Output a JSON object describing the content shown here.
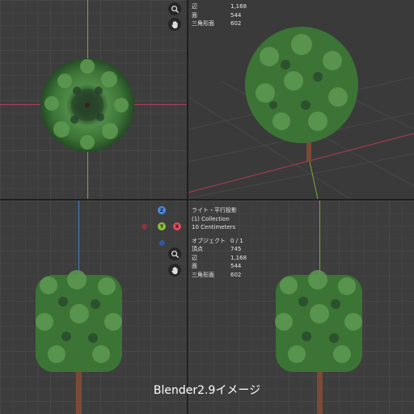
{
  "top_stats": {
    "edges_label": "辺",
    "edges_value": "1,168",
    "faces_label": "面",
    "faces_value": "544",
    "tris_label": "三角形面",
    "tris_value": "602"
  },
  "bottom_overlay": {
    "view_name": "ライト・平行投影",
    "collection": "(1) Collection",
    "scale": "10 Centimeters",
    "objects_label": "オブジェクト",
    "objects_value": "0 / 1",
    "verts_label": "頂点",
    "verts_value": "745",
    "edges_label": "辺",
    "edges_value": "1,168",
    "faces_label": "面",
    "faces_value": "544",
    "tris_label": "三角形面",
    "tris_value": "602"
  },
  "gizmo": {
    "z_label": "Z",
    "y_label": "Y",
    "x_label": "X"
  },
  "caption": "Blender2.9イメージ",
  "colors": {
    "x_axis": "#b04050",
    "y_axis": "#7aa83a",
    "z_axis": "#4a82c8",
    "foliage": "#3f7a3a",
    "trunk": "#7a4a36"
  },
  "icons": [
    "zoom-icon",
    "hand-pan-icon"
  ]
}
